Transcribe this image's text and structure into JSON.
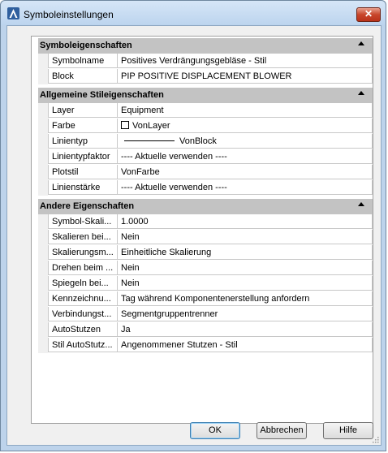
{
  "window": {
    "title": "Symboleinstellungen",
    "close_label": "✕"
  },
  "categories": {
    "symbol": "Symboleigenschaften",
    "style": "Allgemeine Stileigenschaften",
    "other": "Andere Eigenschaften"
  },
  "symbol_props": [
    {
      "name": "Symbolname",
      "value": "Positives Verdrängungsgebläse - Stil"
    },
    {
      "name": "Block",
      "value": "PIP POSITIVE DISPLACEMENT BLOWER"
    }
  ],
  "style_props": {
    "layer": {
      "name": "Layer",
      "value": "Equipment"
    },
    "color": {
      "name": "Farbe",
      "value": "VonLayer"
    },
    "linetype": {
      "name": "Linientyp",
      "value": "VonBlock"
    },
    "linescale": {
      "name": "Linientypfaktor",
      "value": "---- Aktuelle verwenden ----"
    },
    "plotstyle": {
      "name": "Plotstil",
      "value": "VonFarbe"
    },
    "lineweight": {
      "name": "Linienstärke",
      "value": "---- Aktuelle verwenden ----"
    }
  },
  "other_props": [
    {
      "name": "Symbol-Skali...",
      "value": "1.0000"
    },
    {
      "name": "Skalieren bei...",
      "value": "Nein"
    },
    {
      "name": "Skalierungsm...",
      "value": "Einheitliche Skalierung"
    },
    {
      "name": "Drehen beim ...",
      "value": "Nein"
    },
    {
      "name": "Spiegeln bei...",
      "value": "Nein"
    },
    {
      "name": "Kennzeichnu...",
      "value": "Tag während Komponentenerstellung anfordern"
    },
    {
      "name": "Verbindungst...",
      "value": "Segmentgruppentrenner"
    },
    {
      "name": "AutoStutzen",
      "value": "Ja"
    },
    {
      "name": "Stil AutoStutz...",
      "value": "Angenommener Stutzen - Stil"
    }
  ],
  "buttons": {
    "ok": "OK",
    "cancel": "Abbrechen",
    "help": "Hilfe"
  },
  "icons": {
    "app": "autocad-a-icon",
    "close": "close-icon",
    "collapse": "collapse-triangle-icon",
    "grip": "resize-grip-icon"
  },
  "colors": {
    "titlebar": "#bcd4ee",
    "category_bg": "#c3c3c3",
    "close_button": "#c8462b"
  }
}
